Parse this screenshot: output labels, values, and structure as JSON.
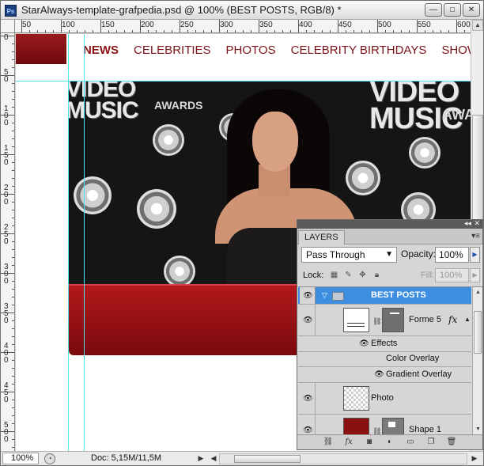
{
  "window": {
    "title": "StarAlways-template-grafpedia.psd @ 100% (BEST POSTS, RGB/8) *",
    "app_icon": "Ps",
    "minimize_glyph": "—",
    "maximize_glyph": "□",
    "close_glyph": "✕"
  },
  "ruler": {
    "h_labels": [
      "50",
      "100",
      "150",
      "200",
      "250",
      "300",
      "350",
      "400",
      "450",
      "500",
      "550",
      "600"
    ],
    "v_labels": [
      "0",
      "50",
      "100",
      "150",
      "200",
      "250",
      "300",
      "350",
      "400",
      "450",
      "500",
      "550",
      "600"
    ]
  },
  "site": {
    "nav": [
      "NEWS",
      "CELEBRITIES",
      "PHOTOS",
      "CELEBRITY BIRTHDAYS",
      "SHOWBIZ FORUM"
    ],
    "vma_left": "VIDEO\nMUSIC",
    "vma_left_awards": "AWARDS",
    "vma_right": "VIDEO\nMUSIC",
    "vma_right_awards": "AWA",
    "colors": {
      "brand_red": "#8c1216",
      "guide": "#4fe3f2"
    }
  },
  "status": {
    "zoom": "100%",
    "doc": "Doc: 5,15M/11,5M"
  },
  "layers_panel": {
    "tab": "LAYERS",
    "blend_mode": "Pass Through",
    "opacity_label": "Opacity:",
    "opacity_value": "100%",
    "lock_label": "Lock:",
    "fill_label": "Fill:",
    "fill_value": "100%",
    "layers": [
      {
        "name": "BEST POSTS",
        "type": "group",
        "selected": true
      },
      {
        "name": "Forme 5",
        "type": "shape",
        "fx": "fx"
      },
      {
        "name": "Effects",
        "type": "effects"
      },
      {
        "name": "Color Overlay",
        "type": "effect"
      },
      {
        "name": "Gradient Overlay",
        "type": "effect"
      },
      {
        "name": "Photo",
        "type": "pixel"
      },
      {
        "name": "Shape 1",
        "type": "shape"
      }
    ]
  }
}
